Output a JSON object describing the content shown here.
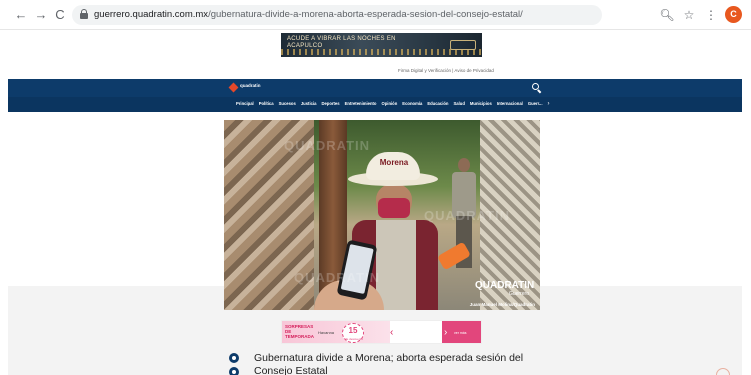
{
  "browser": {
    "back_label": "←",
    "forward_label": "→",
    "reload_label": "C",
    "url_domain": "guerrero.quadratin.com.mx",
    "url_path": "/gubernatura-divide-a-morena-aborta-esperada-sesion-del-consejo-estatal/",
    "zoom_icon": "search-icon",
    "star_icon": "star-icon",
    "profile_initial": "C"
  },
  "top_ad": {
    "text": "ACUDE A VIBRAR LAS NOCHES EN ACAPULCO"
  },
  "site": {
    "topline": "Firma Digital y Verificación | Aviso de Privacidad",
    "logo_text": "quadratin",
    "nav": [
      "Principal",
      "Política",
      "Sucesos",
      "Justicia",
      "Deportes",
      "Entretenimiento",
      "Opinión",
      "Economía",
      "Educación",
      "Salud",
      "Municipios",
      "Internacional",
      "Guerr..."
    ],
    "nav_more": "›"
  },
  "hero": {
    "hat_text": "Morena",
    "watermark": "QUADRATIN",
    "brand_title": "QUADRATIN",
    "brand_sub": "Guerrero",
    "credit": "Juan Manuel Molina/Quadratin"
  },
  "bottom_ad": {
    "promo": "SORPRESAS DE TEMPORADA",
    "brand": "Havanna",
    "pct": "15",
    "pct_sub": "de descuento",
    "right_label": "ver más"
  },
  "article": {
    "headline": "Gubernatura divide a Morena; aborta esperada sesión del Consejo Estatal"
  },
  "colors": {
    "header_bg": "#0d3b6a",
    "accent": "#e5482a"
  }
}
